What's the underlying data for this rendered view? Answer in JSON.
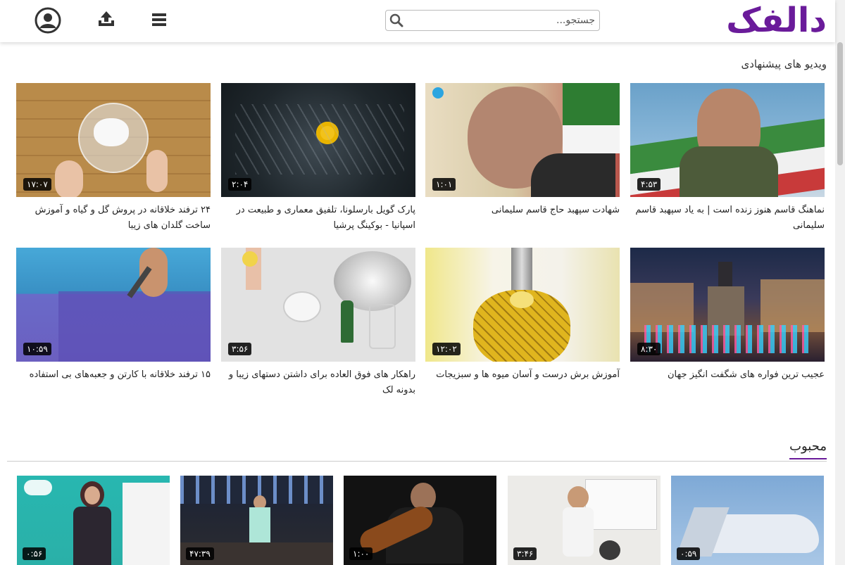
{
  "header": {
    "logo": "دالفک",
    "search_placeholder": "جستجو...",
    "icons": {
      "search": "search-icon",
      "menu": "menu-icon",
      "upload": "upload-icon",
      "user": "user-icon"
    }
  },
  "recommended": {
    "title": "ویدیو های پیشنهادی",
    "videos": [
      {
        "title": "نماهنگ قاسم هنوز زنده است | به یاد سپهبد قاسم سلیمانی",
        "duration": "۴:۵۳"
      },
      {
        "title": "شهادت سپهبد حاج قاسم سلیمانی",
        "duration": "۱:۰۱"
      },
      {
        "title": "پارک گویل بارسلونا، تلفیق معماری و طبیعت در اسپانیا - بوکینگ پرشیا",
        "duration": "۲:۰۴"
      },
      {
        "title": "۲۴ ترفند خلاقانه در پروش گل و گیاه و آموزش ساخت گلدان های زیبا",
        "duration": "۱۷:۰۷"
      },
      {
        "title": "عجیب ترین فواره های شگفت انگیز جهان",
        "duration": "۸:۳۰"
      },
      {
        "title": "آموزش برش درست و آسان میوه ها و سبزیجات",
        "duration": "۱۲:۰۲"
      },
      {
        "title": "راهکار های فوق العاده برای داشتن دستهای زیبا و بدونه لک",
        "duration": "۳:۵۶"
      },
      {
        "title": "۱۵ ترفند خلاقانه با کارتن و جعبه‌های بی استفاده",
        "duration": "۱۰:۵۹"
      }
    ]
  },
  "popular": {
    "title": "محبوب",
    "videos": [
      {
        "duration": "۰:۵۹"
      },
      {
        "duration": "۳:۴۶"
      },
      {
        "duration": "۱:۰۰"
      },
      {
        "duration": "۴۷:۳۹"
      },
      {
        "duration": "۰:۵۶"
      }
    ]
  },
  "colors": {
    "brand": "#6a1b9a"
  }
}
